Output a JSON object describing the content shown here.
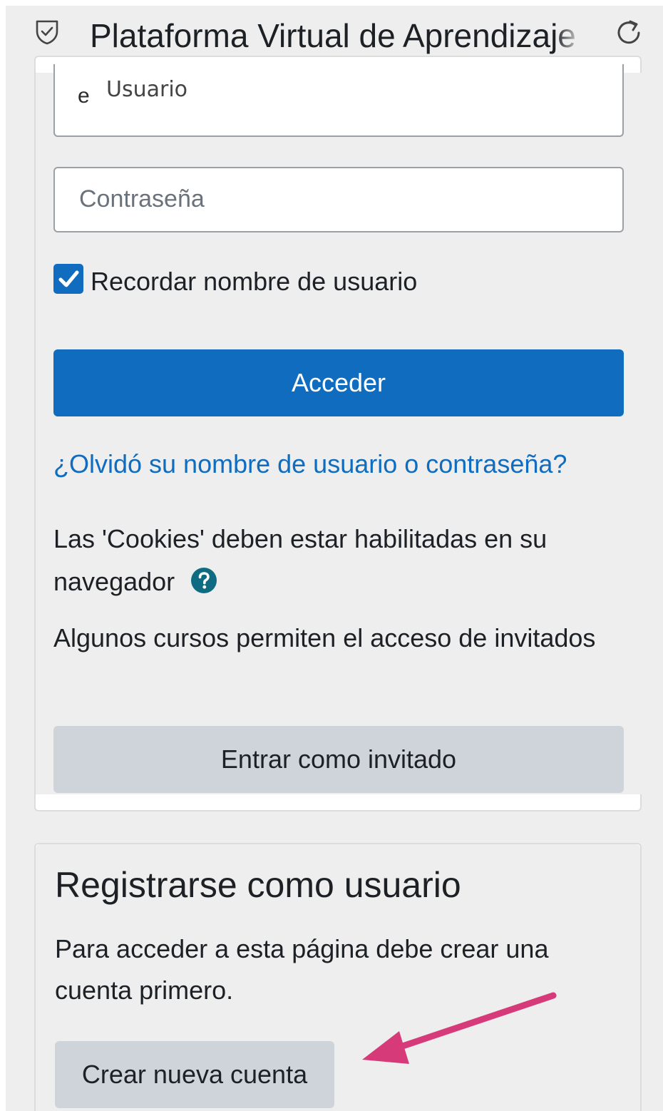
{
  "header": {
    "title": "Plataforma Virtual de Aprendizaje",
    "icons": {
      "left": "shield-check-icon",
      "right": "reload-icon"
    }
  },
  "login": {
    "username_prefix": "e",
    "username_label": "Usuario",
    "password_placeholder": "Contraseña",
    "remember_label": "Recordar nombre de usuario",
    "remember_checked": true,
    "submit_label": "Acceder",
    "forgot_link": "¿Olvidó su nombre de usuario o contraseña?",
    "cookies_text": "Las 'Cookies' deben estar habilitadas en su navegador",
    "help_icon": "question-circle-icon",
    "guest_text": "Algunos cursos permiten el acceso de invitados",
    "guest_button": "Entrar como invitado"
  },
  "signup": {
    "title": "Registrarse como usuario",
    "description": "Para acceder a esta página debe crear una cuenta primero.",
    "create_button": "Crear nueva cuenta"
  },
  "colors": {
    "primary": "#0f6cbf",
    "secondary_button": "#ced4da",
    "background": "#eeeeee",
    "annotation_arrow": "#d63a78"
  }
}
